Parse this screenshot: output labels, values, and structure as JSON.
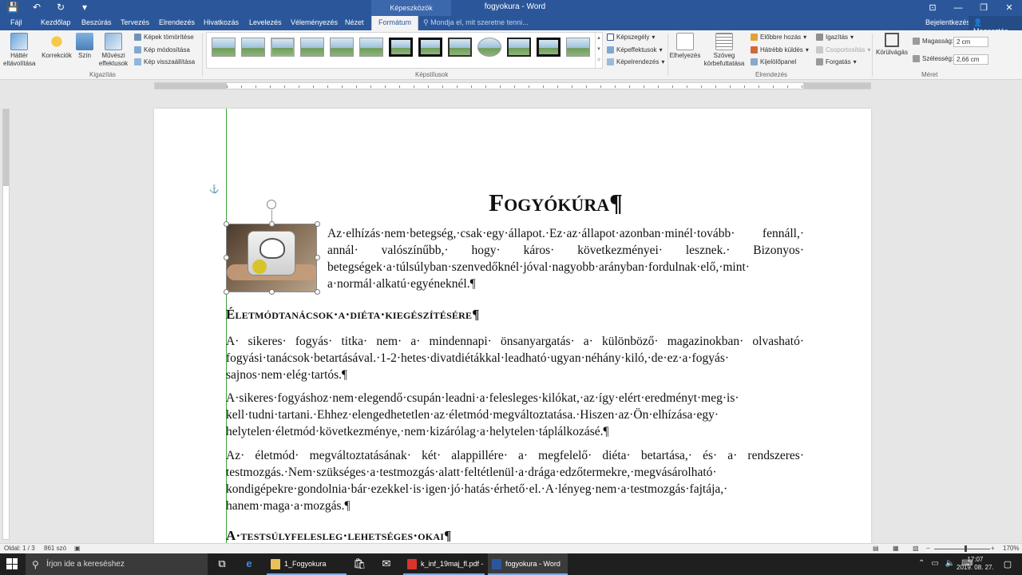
{
  "window": {
    "title": "fogyokura - Word",
    "context_tab_group": "Képeszközök",
    "controls": [
      "⊡",
      "—",
      "❐",
      "✕"
    ]
  },
  "qat": {
    "save": "💾",
    "undo": "↶",
    "redo": "↻",
    "customize": "▾"
  },
  "tabs": [
    {
      "label": "Fájl"
    },
    {
      "label": "Kezdőlap"
    },
    {
      "label": "Beszúrás"
    },
    {
      "label": "Tervezés"
    },
    {
      "label": "Elrendezés"
    },
    {
      "label": "Hivatkozás"
    },
    {
      "label": "Levelezés"
    },
    {
      "label": "Véleményezés"
    },
    {
      "label": "Nézet"
    },
    {
      "label": "Formátum"
    }
  ],
  "tellme": "Mondja el, mit szeretne tenni...",
  "account": {
    "signin": "Bejelentkezés",
    "share": "Megosztás"
  },
  "ribbon": {
    "adjust": {
      "title": "Kigazítás",
      "remove_bg": "Háttér eltávolítása",
      "corrections": "Korrekciók",
      "color": "Szín",
      "artistic": "Művészi effektusok",
      "compress": "Képek tömörítése",
      "change": "Kép módosítása",
      "reset": "Kép visszaállítása"
    },
    "styles": {
      "title": "Képstílusok",
      "border": "Képszegély",
      "effects": "Képeffektusok",
      "layout": "Képelrendezés"
    },
    "arrange": {
      "title": "Elrendezés",
      "position": "Elhelyezés",
      "wrap": "Szöveg körbefuttatása",
      "forward": "Előbbre hozás",
      "backward": "Hátrébb küldés",
      "selection_pane": "Kijelölőpanel",
      "align": "Igazítás",
      "group": "Csoportosítás",
      "rotate": "Forgatás"
    },
    "size": {
      "title": "Méret",
      "crop": "Körülvágás",
      "height_label": "Magasság:",
      "height_value": "2 cm",
      "width_label": "Szélesség:",
      "width_value": "2,66 cm"
    }
  },
  "document": {
    "title": "Fogyókúra¶",
    "intro": "Az·elhízás·nem·betegség,·csak·egy·állapot.·Ez·az·állapot·azonban·minél·tovább· fennáll,· annál· valószínűbb,· hogy· káros· következményei· lesznek.· Bizonyos· betegségek·a·túlsúlyban·szenvedőknél·jóval·nagyobb·arányban·fordulnak·elő,·mint· a·normál·alkatú·egyéneknél.¶",
    "heading1": "Életmódtanácsok·a·diéta·kiegészítésére¶",
    "p1": "A· sikeres· fogyás· titka· nem· a· mindennapi· önsanyargatás· a· különböző· magazinokban· olvasható· fogyási·tanácsok·betartásával.·1-2·hetes·divatdiétákkal·leadható·ugyan·néhány·kiló,·de·ez·a·fogyás· sajnos·nem·elég·tartós.¶",
    "p2": "A·sikeres·fogyáshoz·nem·elegendő·csupán·leadni·a·felesleges·kilókat,·az·így·elért·eredményt·meg·is· kell·tudni·tartani.·Ehhez·elengedhetetlen·az·életmód·megváltoztatása.·Hiszen·az·Ön·elhízása·egy· helytelen·életmód·következménye,·nem·kizárólag·a·helytelen·táplálkozásé.¶",
    "p3": "Az· életmód· megváltoztatásának· két· alappillére· a· megfelelő· diéta· betartása,· és· a· rendszeres· testmozgás.·Nem·szükséges·a·testmozgás·alatt·feltétlenül·a·drága·edzőtermekre,·megvásárolható· kondigépekre·gondolnia·bár·ezekkel·is·igen·jó·hatás·érhető·el.·A·lényeg·nem·a·testmozgás·fajtája,· hanem·maga·a·mozgás.¶",
    "heading2": "A·testsúlyfelesleg·lehetséges·okai¶"
  },
  "status": {
    "page": "Oldal: 1 / 3",
    "words": "861 szó",
    "zoom": "170%"
  },
  "taskbar": {
    "search_placeholder": "Írjon ide a kereséshez",
    "apps": [
      {
        "label": "1_Fogyokura",
        "color": "#e8c15a"
      },
      {
        "label": "k_inf_19maj_fl.pdf - ...",
        "color": "#d9342b"
      },
      {
        "label": "fogyokura - Word",
        "color": "#2b579a"
      }
    ],
    "time": "17:07",
    "date": "2019. 08. 27."
  }
}
